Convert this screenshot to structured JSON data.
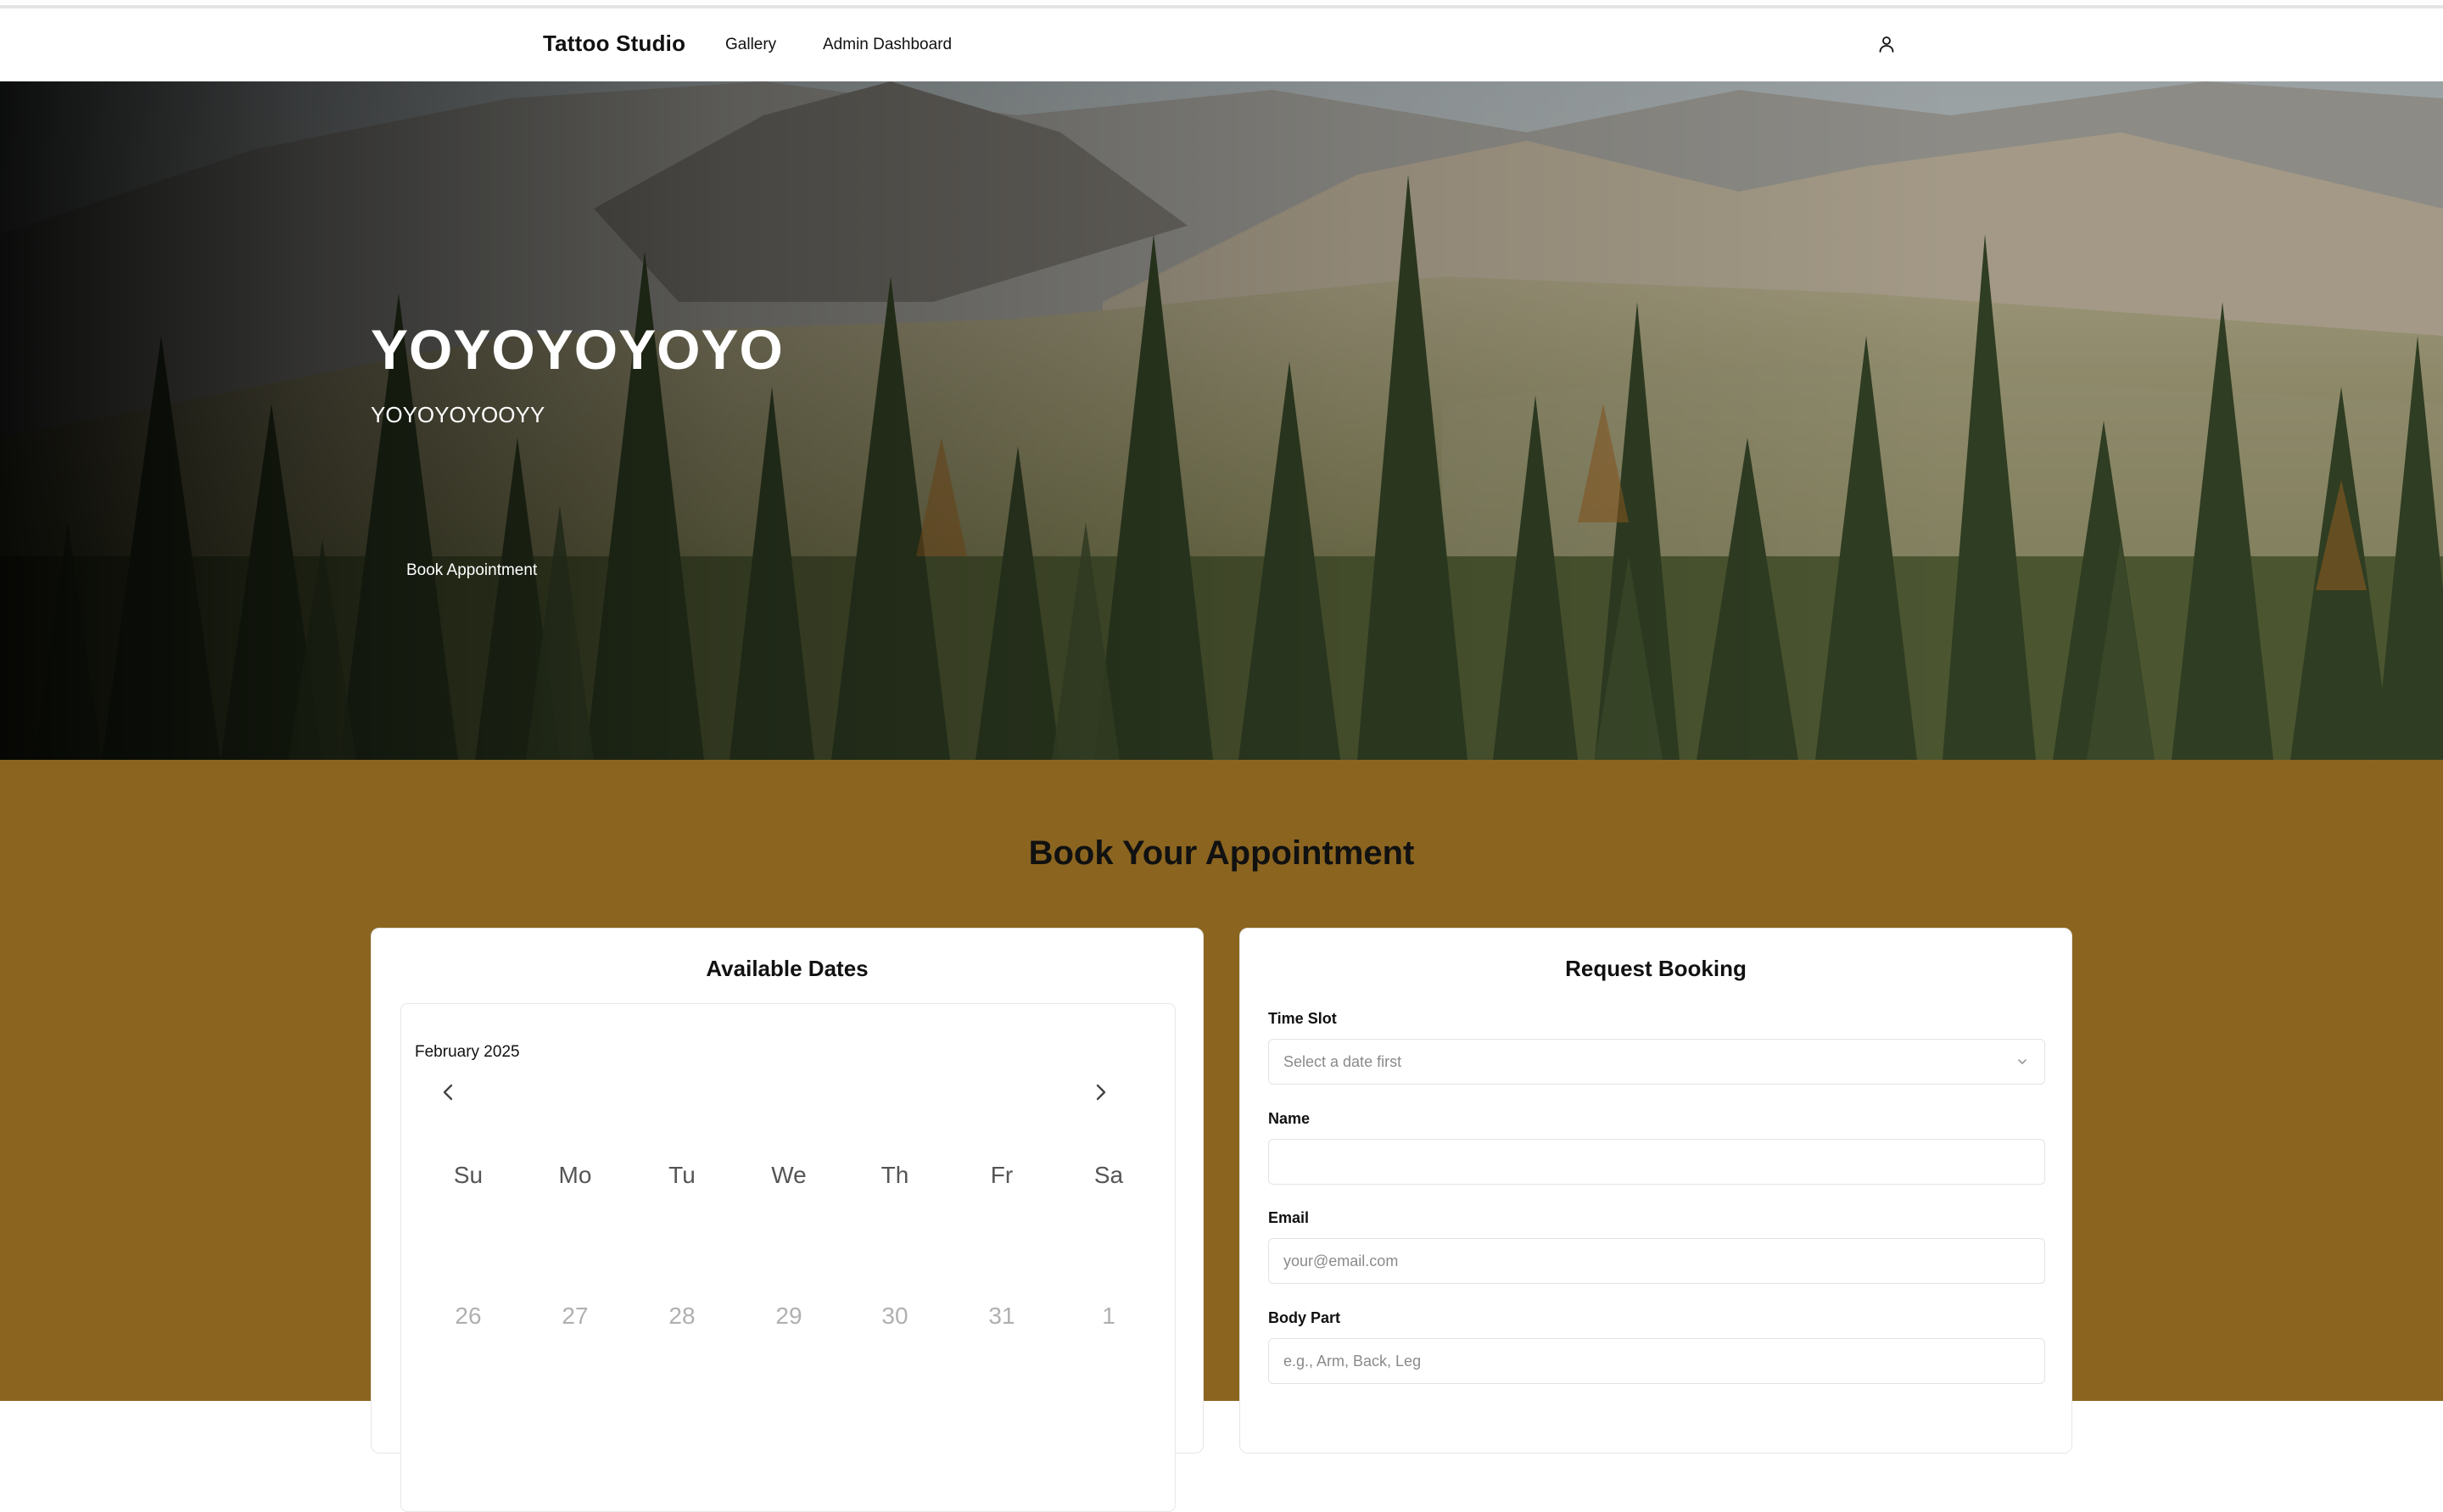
{
  "nav": {
    "brand": "Tattoo Studio",
    "links": [
      {
        "label": "Gallery"
      },
      {
        "label": "Admin Dashboard"
      }
    ],
    "user_icon": "user-icon"
  },
  "hero": {
    "title": "YOYOYOYOYO",
    "subtitle": "YOYOYOYOOYY",
    "button_label": "Book Appointment"
  },
  "booking": {
    "title": "Book Your Appointment",
    "background_color": "#8b6520",
    "calendar_card": {
      "title": "Available Dates",
      "month_label": "February 2025",
      "weekdays": [
        "Su",
        "Mo",
        "Tu",
        "We",
        "Th",
        "Fr",
        "Sa"
      ],
      "week1_days": [
        "26",
        "27",
        "28",
        "29",
        "30",
        "31",
        "1"
      ],
      "prev_icon": "chevron-left-icon",
      "next_icon": "chevron-right-icon"
    },
    "request_card": {
      "title": "Request Booking",
      "time_slot": {
        "label": "Time Slot",
        "placeholder": "Select a date first",
        "icon": "chevron-down-icon"
      },
      "name": {
        "label": "Name",
        "value": "",
        "placeholder": ""
      },
      "email": {
        "label": "Email",
        "placeholder": "your@email.com"
      },
      "body_part": {
        "label": "Body Part",
        "placeholder": "e.g., Arm, Back, Leg"
      }
    }
  }
}
